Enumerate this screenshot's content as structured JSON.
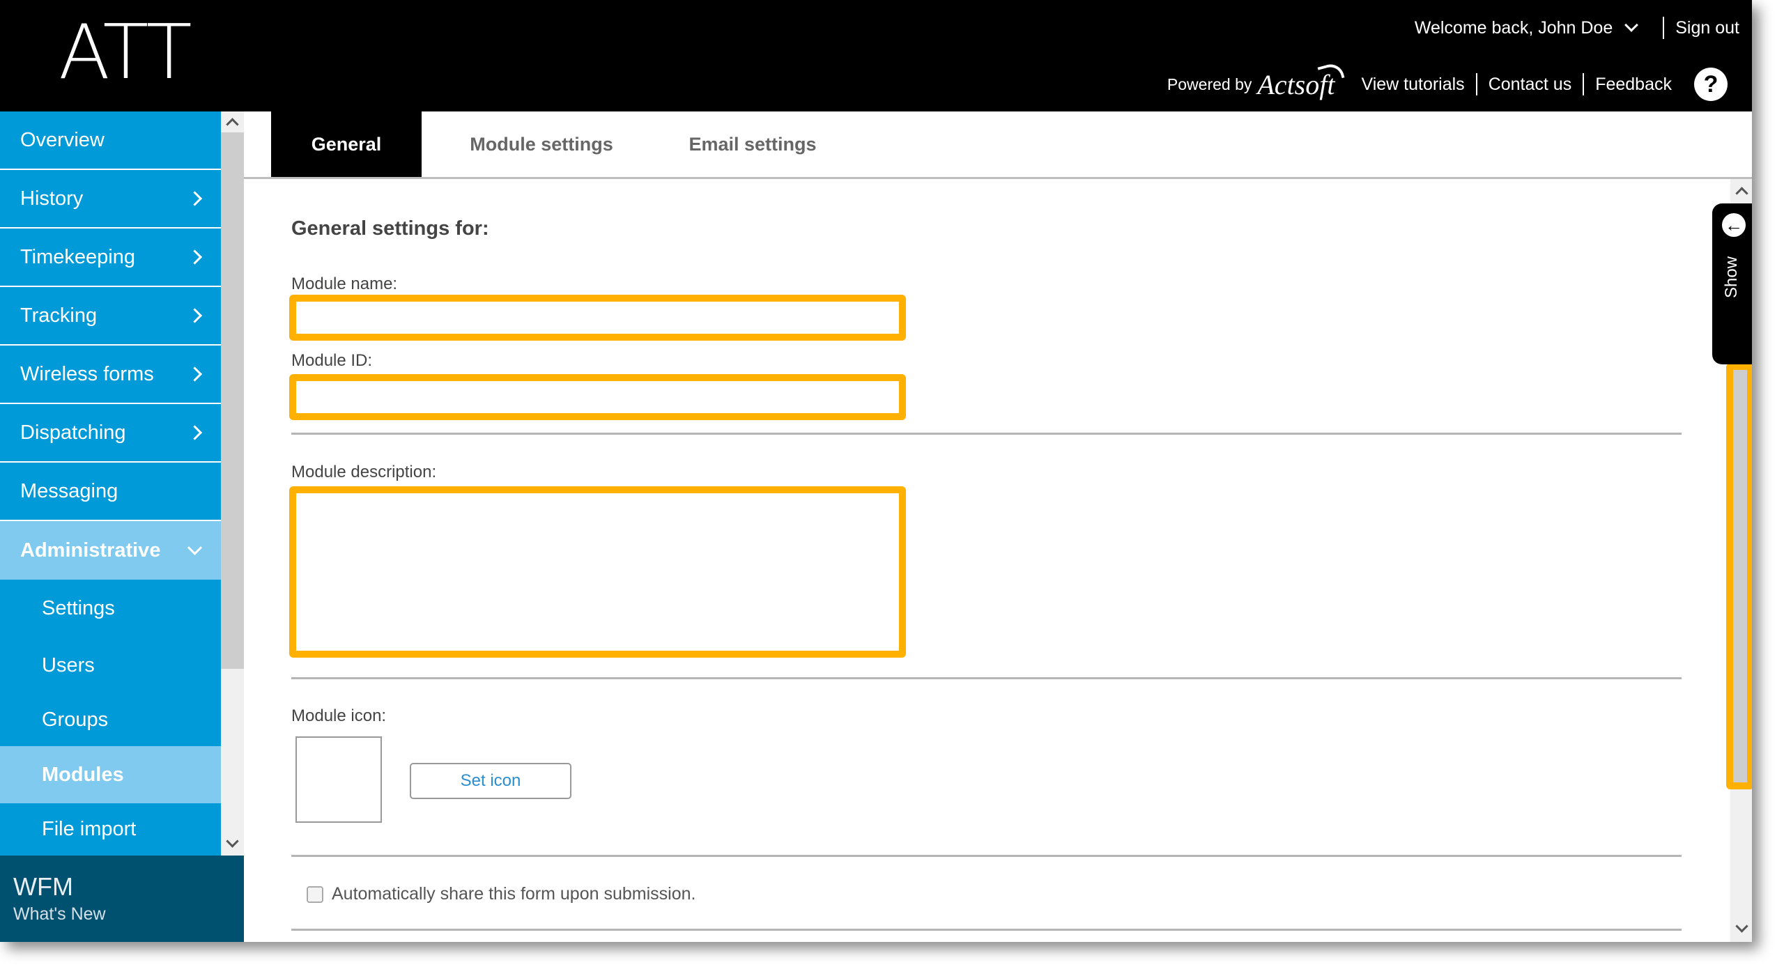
{
  "header": {
    "logo": "ATT",
    "welcome": "Welcome back, John Doe",
    "sign_out": "Sign out",
    "powered_by": "Powered by",
    "brand": "Actsoft",
    "links": [
      "View tutorials",
      "Contact us",
      "Feedback"
    ],
    "help_glyph": "?"
  },
  "sidebar": {
    "items": [
      {
        "label": "Overview",
        "has_arrow": false
      },
      {
        "label": "History",
        "has_arrow": true
      },
      {
        "label": "Timekeeping",
        "has_arrow": true
      },
      {
        "label": "Tracking",
        "has_arrow": true
      },
      {
        "label": "Wireless forms",
        "has_arrow": true
      },
      {
        "label": "Dispatching",
        "has_arrow": true
      },
      {
        "label": "Messaging",
        "has_arrow": false
      },
      {
        "label": "Administrative",
        "has_arrow": true,
        "expanded": true
      }
    ],
    "subitems": [
      {
        "label": "Settings"
      },
      {
        "label": "Users"
      },
      {
        "label": "Groups"
      },
      {
        "label": "Modules",
        "active": true
      },
      {
        "label": "File import"
      }
    ],
    "footer": {
      "title": "WFM",
      "subtitle": "What's New"
    }
  },
  "tabs": [
    {
      "label": "General",
      "active": true
    },
    {
      "label": "Module settings",
      "active": false
    },
    {
      "label": "Email settings",
      "active": false
    }
  ],
  "form": {
    "heading": "General settings for:",
    "module_name_label": "Module name:",
    "module_name_value": "",
    "module_id_label": "Module ID:",
    "module_id_value": "",
    "module_description_label": "Module description:",
    "module_description_value": "",
    "module_icon_label": "Module icon:",
    "set_icon_button": "Set icon",
    "auto_share_label": "Automatically share this form upon submission.",
    "auto_share_checked": false
  },
  "side_panel": {
    "label": "Show",
    "icon": "arrow-left-circle"
  },
  "colors": {
    "header_bg": "#000000",
    "nav_blue": "#009ad8",
    "nav_active": "#7fcaee",
    "footer_bg": "#00516f",
    "highlight": "#ffb000",
    "link_blue": "#2a8ed0"
  }
}
